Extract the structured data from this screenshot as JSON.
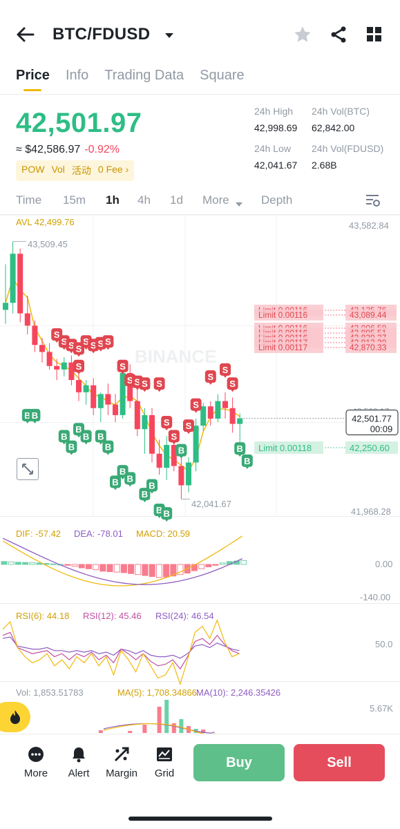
{
  "header": {
    "pair": "BTC/FDUSD",
    "tabs": [
      "Price",
      "Info",
      "Trading Data",
      "Square"
    ],
    "active_tab": "Price"
  },
  "ticker": {
    "last_price": "42,501.97",
    "usd_price": "≈ $42,586.97",
    "change": "-0.92%",
    "tags": [
      "POW",
      "Vol",
      "活动",
      "0 Fee ›"
    ],
    "stats": {
      "high_label": "24h High",
      "high": "42,998.69",
      "vol_btc_label": "24h Vol(BTC)",
      "vol_btc": "62,842.00",
      "low_label": "24h Low",
      "low": "42,041.67",
      "vol_fdusd_label": "24h Vol(FDUSD)",
      "vol_fdusd": "2.68B"
    }
  },
  "intervals": {
    "items": [
      "Time",
      "15m",
      "1h",
      "4h",
      "1d",
      "More",
      "Depth"
    ],
    "active": "1h"
  },
  "chart": {
    "avl_label": "AVL 42,499.76",
    "y_max_label": "43,582.84",
    "y_min_label": "41,968.28",
    "y_mid_label": "42,500.17",
    "peak_label": "43,509.45",
    "trough_label": "42,041.67",
    "current_price_label": "42,501.77",
    "countdown": "00:09",
    "watermark": "BINANCE",
    "sell_orders": [
      {
        "label": "Limit  0.00116",
        "price": "43,125.76"
      },
      {
        "label": "Limit  0.00116",
        "price": "43,089.44"
      },
      {
        "label": "Limit  0.00116",
        "price": "43,006.59"
      },
      {
        "label": "Limit  0.00116",
        "price": "42,995.51"
      },
      {
        "label": "Limit  0.00116",
        "price": "42,939.27"
      },
      {
        "label": "Limit  0.00117",
        "price": "42,912.39"
      },
      {
        "label": "Limit  0.00117",
        "price": "42,870.33"
      }
    ],
    "buy_order": {
      "label": "Limit  0.00118",
      "price": "42,250.60"
    },
    "candles": [
      [
        43120,
        43380,
        43040,
        43160
      ],
      [
        43160,
        43509,
        43100,
        43440
      ],
      [
        43440,
        43470,
        43050,
        43100
      ],
      [
        43100,
        43200,
        42980,
        43030
      ],
      [
        43030,
        43060,
        42880,
        42920
      ],
      [
        42920,
        42960,
        42820,
        42880
      ],
      [
        42880,
        42930,
        42780,
        42800
      ],
      [
        42800,
        42840,
        42720,
        42780
      ],
      [
        42780,
        42850,
        42740,
        42820
      ],
      [
        42820,
        42860,
        42690,
        42720
      ],
      [
        42720,
        42760,
        42600,
        42650
      ],
      [
        42650,
        42720,
        42580,
        42690
      ],
      [
        42690,
        42730,
        42520,
        42560
      ],
      [
        42560,
        42650,
        42480,
        42640
      ],
      [
        42640,
        42700,
        42520,
        42580
      ],
      [
        42580,
        42640,
        42480,
        42520
      ],
      [
        42520,
        42800,
        42500,
        42760
      ],
      [
        42760,
        42810,
        42560,
        42600
      ],
      [
        42600,
        42680,
        42400,
        42440
      ],
      [
        42440,
        42560,
        42300,
        42520
      ],
      [
        42520,
        42560,
        42250,
        42300
      ],
      [
        42300,
        42380,
        42180,
        42220
      ],
      [
        42220,
        42400,
        42150,
        42350
      ],
      [
        42350,
        42420,
        42200,
        42230
      ],
      [
        42230,
        42300,
        42041,
        42120
      ],
      [
        42120,
        42280,
        42080,
        42250
      ],
      [
        42250,
        42500,
        42200,
        42460
      ],
      [
        42460,
        42590,
        42430,
        42570
      ],
      [
        42570,
        42600,
        42460,
        42500
      ],
      [
        42500,
        42640,
        42480,
        42600
      ],
      [
        42600,
        42650,
        42500,
        42560
      ],
      [
        42560,
        42620,
        42420,
        42470
      ],
      [
        42470,
        42530,
        42300,
        42502
      ]
    ],
    "sell_markers": [
      [
        7,
        42980
      ],
      [
        8,
        42940
      ],
      [
        9,
        42920
      ],
      [
        10,
        42900
      ],
      [
        11,
        42940
      ],
      [
        12,
        42920
      ],
      [
        13,
        42930
      ],
      [
        14,
        42940
      ],
      [
        10,
        42800
      ],
      [
        16,
        42800
      ],
      [
        17,
        42720
      ],
      [
        18,
        42710
      ],
      [
        19,
        42700
      ],
      [
        21,
        42700
      ],
      [
        22,
        42480
      ],
      [
        23,
        42400
      ],
      [
        25,
        42460
      ],
      [
        26,
        42580
      ],
      [
        28,
        42740
      ],
      [
        30,
        42780
      ],
      [
        31,
        42700
      ]
    ],
    "buy_markers": [
      [
        3,
        42520
      ],
      [
        4,
        42520
      ],
      [
        8,
        42400
      ],
      [
        9,
        42340
      ],
      [
        10,
        42440
      ],
      [
        11,
        42400
      ],
      [
        13,
        42400
      ],
      [
        14,
        42340
      ],
      [
        16,
        42200
      ],
      [
        15,
        42140
      ],
      [
        17,
        42160
      ],
      [
        20,
        42120
      ],
      [
        19,
        42070
      ],
      [
        21,
        41980
      ],
      [
        22,
        41960
      ],
      [
        24,
        42320
      ],
      [
        32,
        42330
      ],
      [
        33,
        42260
      ]
    ]
  },
  "macd": {
    "dif": "DIF: -57.42",
    "dea": "DEA: -78.01",
    "macd": "MACD: 20.59",
    "zero_label": "0.00",
    "min_label": "-140.00",
    "hist": [
      12,
      10,
      9,
      8,
      8,
      6,
      4,
      2,
      0,
      -4,
      -8,
      -14,
      -18,
      -22,
      -28,
      -30,
      -32,
      -34,
      -38,
      -42,
      -46,
      -50,
      -54,
      -52,
      -48,
      -42,
      -36,
      -26,
      -18,
      -10,
      -4,
      6,
      12,
      14,
      16
    ]
  },
  "rsi": {
    "rsi6": "RSI(6): 44.18",
    "rsi12": "RSI(12): 45.46",
    "rsi24": "RSI(24): 46.54",
    "mid_label": "50.0",
    "rsi6_series": [
      60,
      65,
      48,
      42,
      38,
      40,
      44,
      36,
      40,
      34,
      42,
      38,
      44,
      36,
      42,
      30,
      46,
      40,
      32,
      44,
      36,
      28,
      30,
      38,
      24,
      40,
      58,
      62,
      54,
      66,
      52,
      42,
      44
    ],
    "rsi12_series": [
      56,
      58,
      48,
      46,
      44,
      45,
      46,
      42,
      44,
      40,
      44,
      42,
      45,
      40,
      43,
      38,
      47,
      44,
      40,
      44,
      39,
      36,
      37,
      40,
      34,
      42,
      52,
      54,
      50,
      56,
      50,
      46,
      44
    ],
    "rsi24_series": [
      54,
      55,
      49,
      48,
      47,
      47,
      48,
      46,
      46,
      45,
      46,
      45,
      46,
      44,
      45,
      43,
      47,
      46,
      44,
      46,
      43,
      42,
      42,
      43,
      41,
      44,
      49,
      50,
      48,
      51,
      49,
      47,
      46
    ]
  },
  "volume": {
    "vol": "Vol: 1,853.51783",
    "ma5": "MA(5): 1,708.34866",
    "ma10": "MA(10): 2,246.35426",
    "max_label": "5.67K"
  },
  "bottom_nav": {
    "items": [
      "More",
      "Alert",
      "Margin",
      "Grid"
    ],
    "buy": "Buy",
    "sell": "Sell"
  },
  "colors": {
    "up": "#2ebd85",
    "down": "#f6465d",
    "accent": "#f0b90b",
    "macd_dea": "#8e5cc2",
    "rsi12": "#c04fa0"
  }
}
